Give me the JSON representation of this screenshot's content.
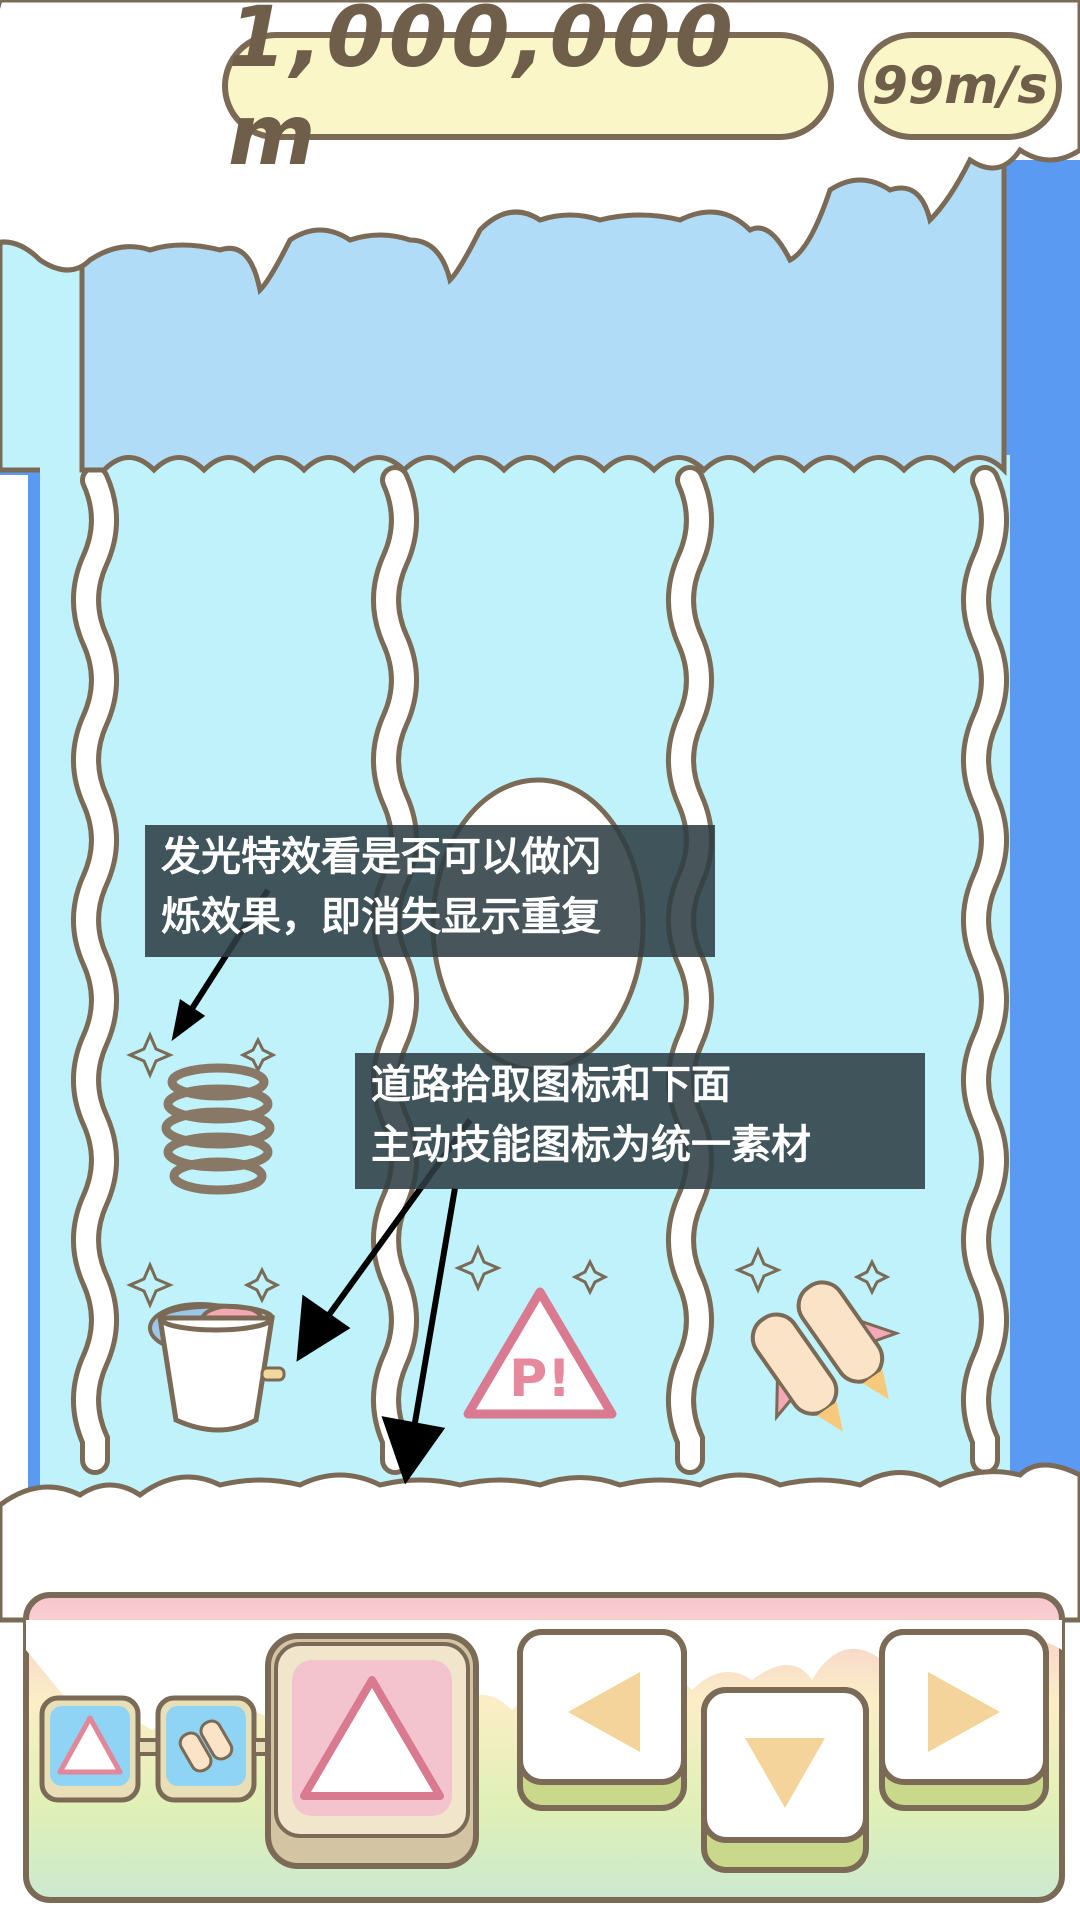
{
  "hud": {
    "distance": "1,000,000 m",
    "speed": "99m/s",
    "pause_icon": "pause-icon"
  },
  "annotations": {
    "glow": {
      "line1": "发光特效看是否可以做闪",
      "line2": "烁效果，即消失显示重复"
    },
    "icons": {
      "line1": "道路拾取图标和下面",
      "line2": "主动技能图标为统一素材"
    }
  },
  "pickups": {
    "spring": "spring-icon",
    "fish_bucket": "fish-bucket-icon",
    "p_warning": "p-warning-icon",
    "p_warning_label": "P!",
    "rocket": "jetpack-icon"
  },
  "controls": {
    "skill_slots": [
      "p-warning-icon",
      "jetpack-icon"
    ],
    "active_skill": "p-warning-icon",
    "left": "left-arrow-icon",
    "down": "down-arrow-icon",
    "right": "right-arrow-icon"
  },
  "colors": {
    "outline": "#7b6a55",
    "ice_light": "#bff2fb",
    "ice_top": "#b0dcf8",
    "river_blue": "#5b9af2",
    "p_pink": "#f0a0b0",
    "arrow_tan": "#f4d49a",
    "hud_yellow": "#fbf6c8",
    "pause_green": "#d9e37e"
  }
}
